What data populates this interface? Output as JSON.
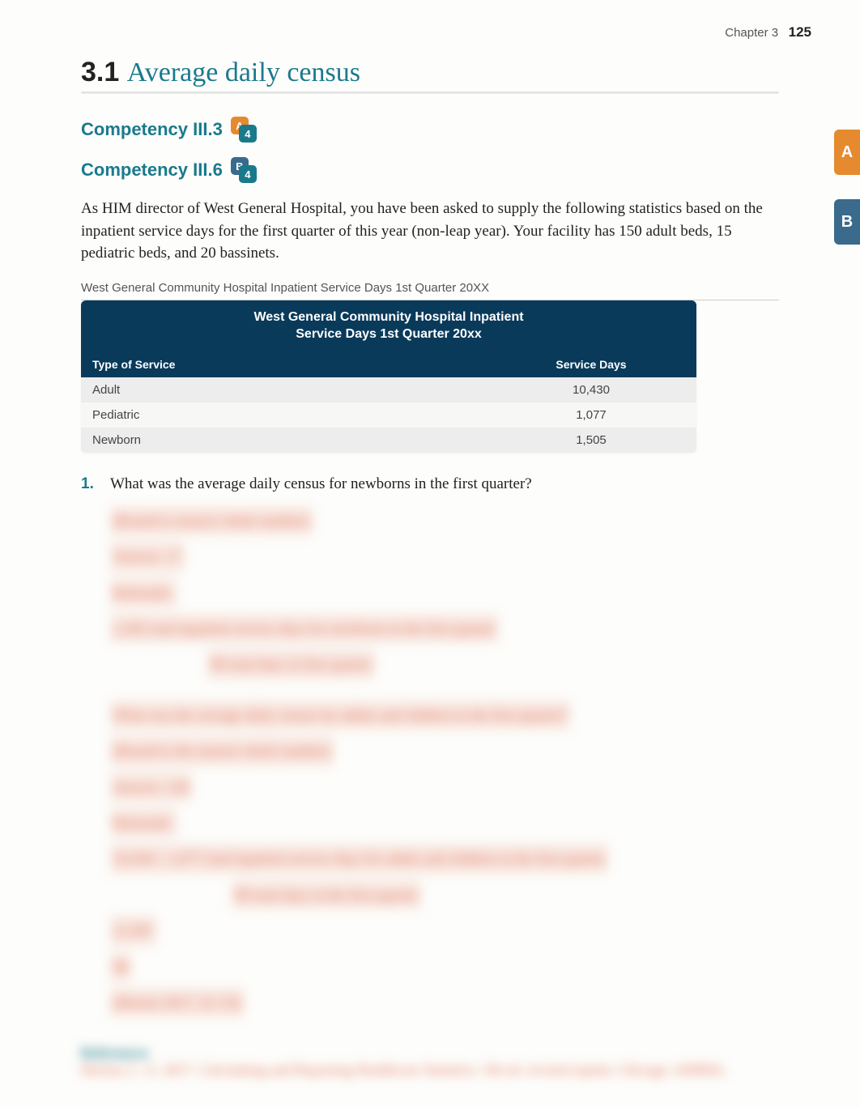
{
  "header": {
    "chapter_label": "Chapter 3",
    "page_number": "125"
  },
  "section": {
    "number": "3.1",
    "title": "Average daily census"
  },
  "competencies": [
    {
      "label": "Competency III.3",
      "badge_top": "A",
      "badge_bottom": "4"
    },
    {
      "label": "Competency III.6",
      "badge_top": "B",
      "badge_bottom": "4"
    }
  ],
  "intro_paragraph": "As HIM director of West General Hospital, you have been asked to supply the following statistics based on the inpatient service days for the first quarter of this year (non-leap year). Your facility has 150 adult beds, 15 pediatric beds, and 20 bassinets.",
  "table": {
    "caption": "West General Community Hospital Inpatient Service Days 1st Quarter 20XX",
    "title_line1": "West General Community Hospital Inpatient",
    "title_line2": "Service Days 1st Quarter 20xx",
    "col1": "Type of Service",
    "col2": "Service Days",
    "rows": [
      {
        "type": "Adult",
        "days": "10,430"
      },
      {
        "type": "Pediatric",
        "days": "1,077"
      },
      {
        "type": "Newborn",
        "days": "1,505"
      }
    ]
  },
  "questions": [
    {
      "num": "1.",
      "text": "What was the average daily census for newborns in the first quarter?"
    }
  ],
  "side_tabs": [
    {
      "label": "A",
      "color": "orange"
    },
    {
      "label": "B",
      "color": "blue"
    }
  ],
  "obscured": {
    "answer_block_1": [
      "(Round to nearest whole number)",
      "Answer: 17",
      "Rationale:",
      "1,505 total inpatient service days for newborns in the first quarter",
      "90 total days in first quarter"
    ],
    "question_2": "What was the average daily census for adults and children in the first quarter?",
    "answer_block_2": [
      "(Round to the nearest whole number)",
      "Answer: 128",
      "Rationale:",
      "10,430 + 1,077 total inpatient service days for adults and children in the first quarter",
      "90 total days in the first quarter",
      "11,507",
      "90",
      "(Horton 2017, 52–53)"
    ],
    "references_heading": "References",
    "references_text": "Horton, L. A. 2017. Calculating and Reporting Healthcare Statistics. 5th ed. revised reprint. Chicago: AHIMA."
  }
}
